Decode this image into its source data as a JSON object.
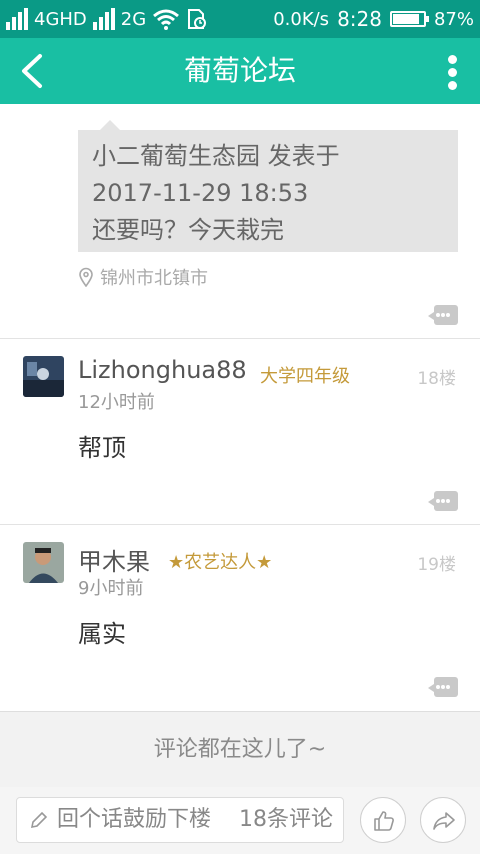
{
  "status_bar": {
    "network_1": "4GHD",
    "network_2": "2G",
    "speed": "0.0K/s",
    "time": "8:28",
    "battery": "87%",
    "battery_level": 0.87
  },
  "header": {
    "title": "葡萄论坛"
  },
  "quote": {
    "line1": "小二葡萄生态园 发表于",
    "line2": "2017-11-29 18:53",
    "line3": "还要吗？今天栽完"
  },
  "location": "锦州市北镇市",
  "replies": [
    {
      "username": "Lizhonghua88",
      "level": "大学四年级",
      "floor": "18楼",
      "time": "12小时前",
      "body": "帮顶"
    },
    {
      "username": "甲木果",
      "level": "★农艺达人★",
      "floor": "19楼",
      "time": "9小时前",
      "body": "属实"
    }
  ],
  "end_message": "评论都在这儿了~",
  "bottom_bar": {
    "placeholder": "回个话鼓励下楼",
    "comment_count": "18条评论"
  },
  "colors": {
    "status_bar": "#0a9a86",
    "header": "#19bfa3",
    "level": "#c49a3a"
  }
}
